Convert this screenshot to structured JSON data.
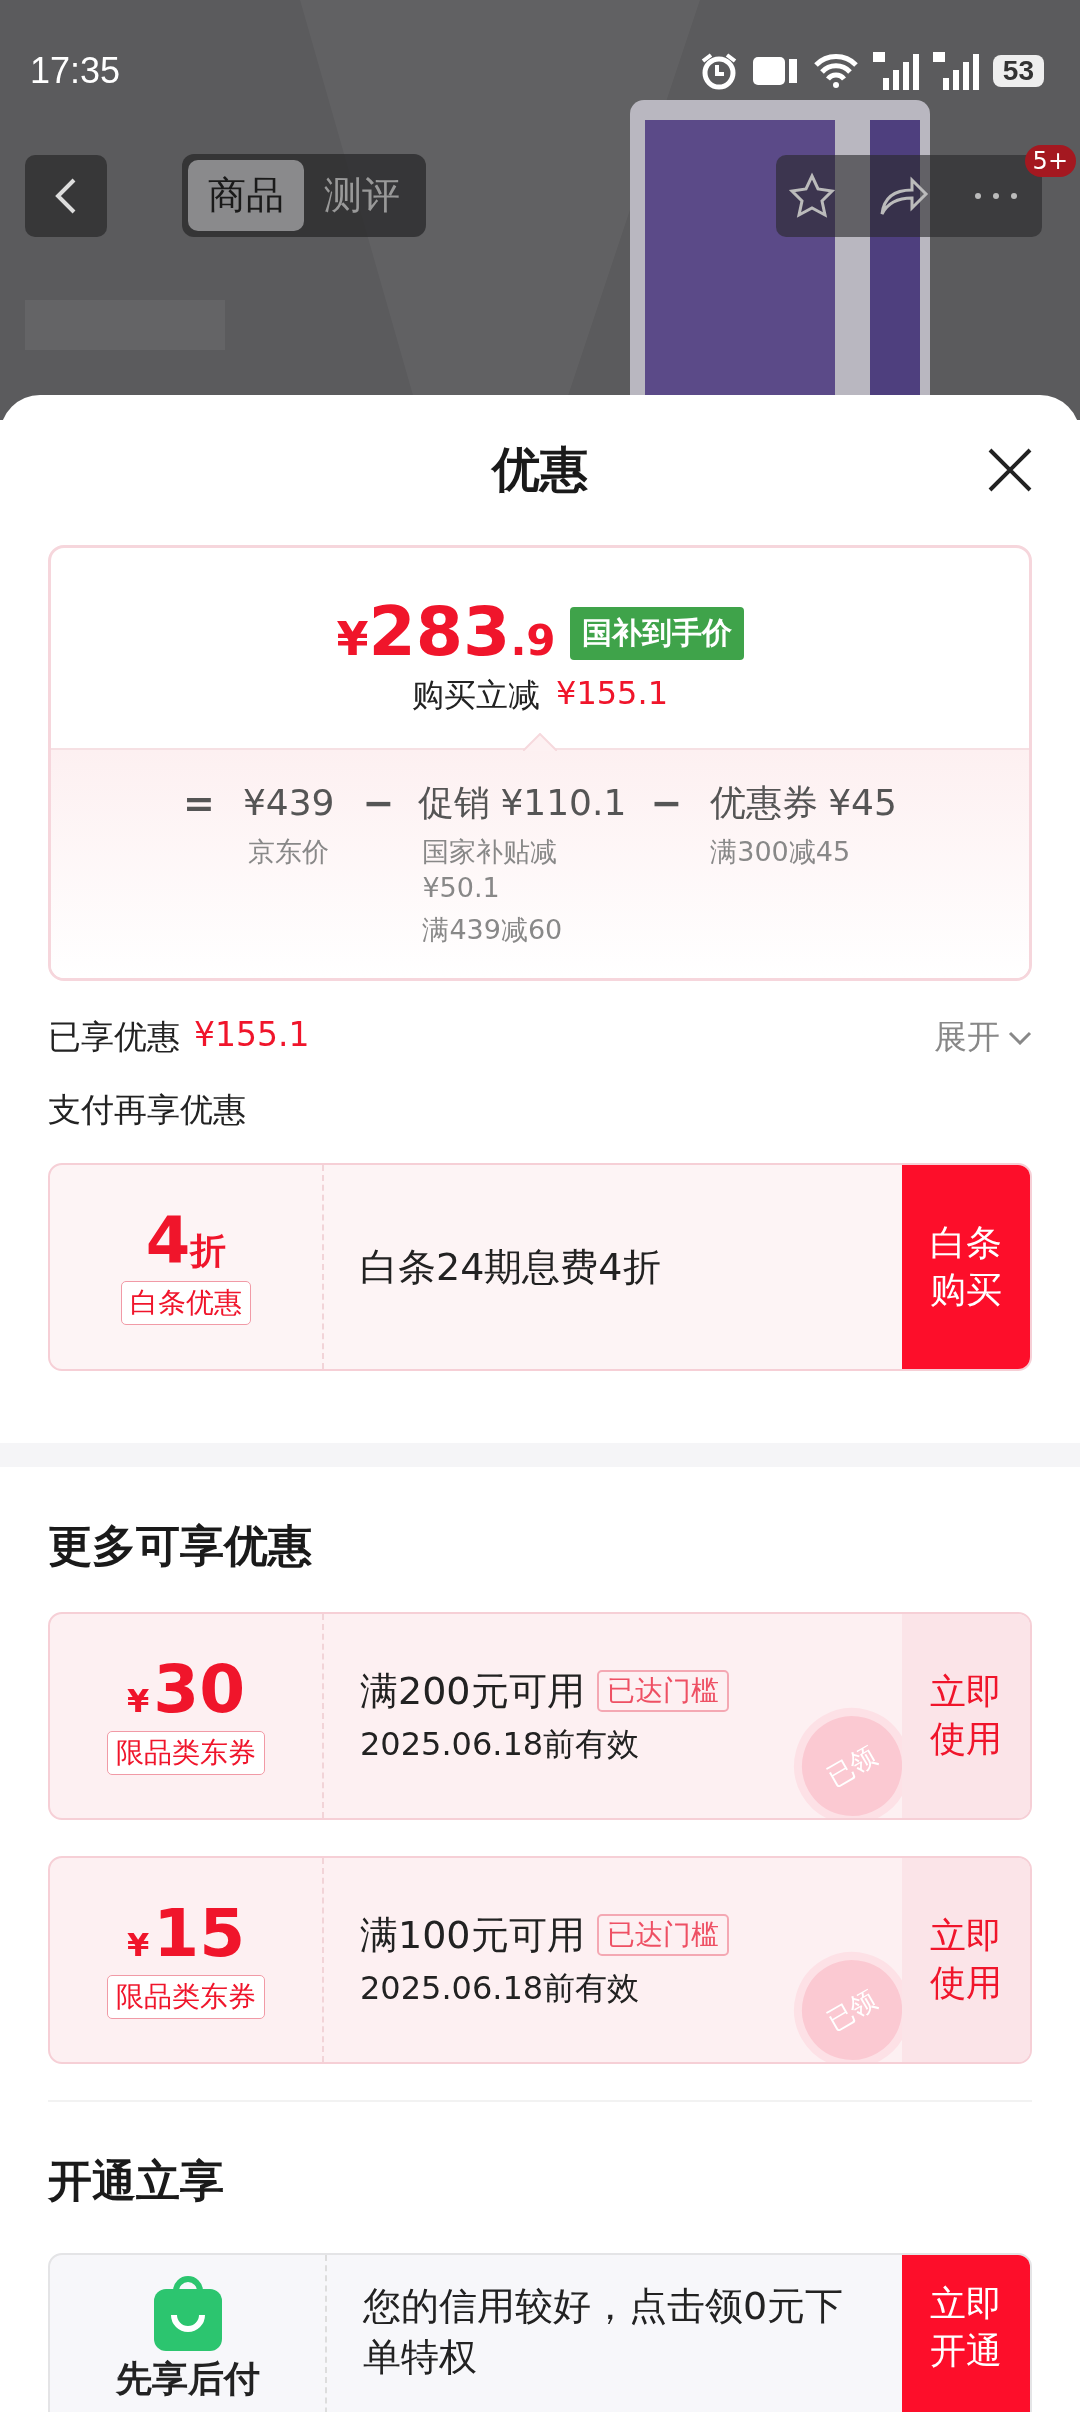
{
  "status_bar": {
    "time": "17:35",
    "battery": "53"
  },
  "nav": {
    "tabs": [
      {
        "label": "商品",
        "selected": true
      },
      {
        "label": "测评",
        "selected": false
      }
    ],
    "badge": "5+"
  },
  "sheet": {
    "title": "优惠"
  },
  "price_card": {
    "currency": "¥",
    "price_int": "283",
    "price_dec": ".9",
    "tag": "国补到手价",
    "saving_label": "购买立减",
    "saving": "¥155.1",
    "formula": [
      {
        "kind": "op",
        "text": "="
      },
      {
        "kind": "term",
        "amount": "¥439",
        "notes": [
          "京东价"
        ]
      },
      {
        "kind": "op",
        "text": "−"
      },
      {
        "kind": "term",
        "label": "促销",
        "amount": "¥110.1",
        "notes": [
          "国家补贴减¥50.1",
          "满439减60"
        ]
      },
      {
        "kind": "op",
        "text": "−"
      },
      {
        "kind": "term",
        "label": "优惠券",
        "amount": "¥45",
        "notes": [
          "满300减45"
        ]
      }
    ]
  },
  "enjoyed": {
    "label": "已享优惠",
    "amount": "¥155.1",
    "toggle": "展开"
  },
  "pay_more": "支付再享优惠",
  "baitiao": {
    "big": "4",
    "unit": "折",
    "tag": "白条优惠",
    "text": "白条24期息费4折",
    "button": "白条购买"
  },
  "more_title": "更多可享优惠",
  "coupons": [
    {
      "currency": "¥",
      "amount": "30",
      "tag": "限品类东券",
      "condition": "满200元可用",
      "badge": "已达门槛",
      "validity": "2025.06.18前有效",
      "button": "立即使用",
      "stamp": "已领"
    },
    {
      "currency": "¥",
      "amount": "15",
      "tag": "限品类东券",
      "condition": "满100元可用",
      "badge": "已达门槛",
      "validity": "2025.06.18前有效",
      "button": "立即使用",
      "stamp": "已领"
    }
  ],
  "open_title": "开通立享",
  "open_card": {
    "name": "先享后付",
    "text": "您的信用较好，点击领0元下单特权",
    "button": "立即开通"
  }
}
